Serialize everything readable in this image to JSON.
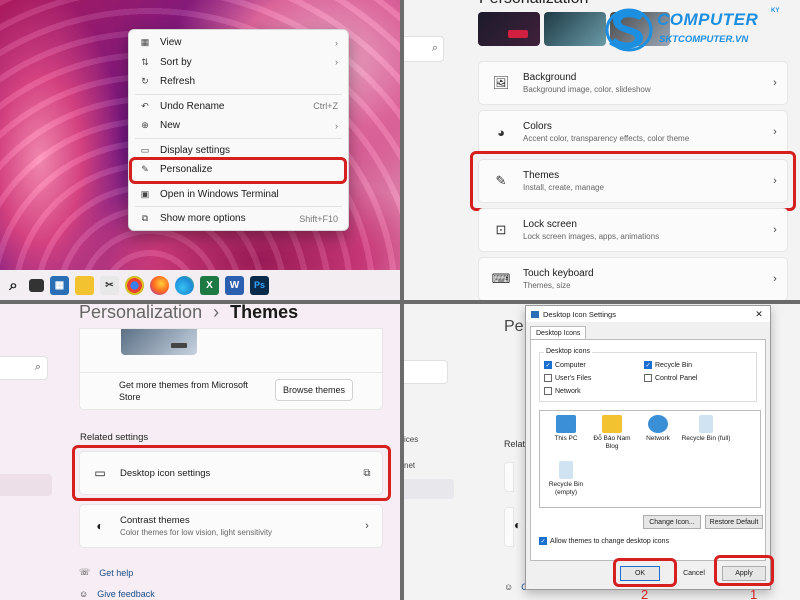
{
  "context_menu": {
    "items": [
      {
        "icon": "view-icon",
        "label": "View",
        "shortcut": "",
        "arrow": "›"
      },
      {
        "icon": "sort-icon",
        "label": "Sort by",
        "shortcut": "",
        "arrow": "›"
      },
      {
        "icon": "refresh-icon",
        "label": "Refresh",
        "shortcut": "",
        "arrow": ""
      },
      {
        "icon": "undo-icon",
        "label": "Undo Rename",
        "shortcut": "Ctrl+Z",
        "arrow": ""
      },
      {
        "icon": "new-icon",
        "label": "New",
        "shortcut": "",
        "arrow": "›"
      },
      {
        "icon": "display-icon",
        "label": "Display settings",
        "shortcut": "",
        "arrow": ""
      },
      {
        "icon": "brush-icon",
        "label": "Personalize",
        "shortcut": "",
        "arrow": ""
      },
      {
        "icon": "terminal-icon",
        "label": "Open in Windows Terminal",
        "shortcut": "",
        "arrow": ""
      },
      {
        "icon": "more-options-icon",
        "label": "Show more options",
        "shortcut": "Shift+F10",
        "arrow": ""
      }
    ]
  },
  "settings_list": {
    "partial_title": "Personalization",
    "cards": [
      {
        "icon": "background-icon",
        "title": "Background",
        "subtitle": "Background image, color, slideshow"
      },
      {
        "icon": "colors-icon",
        "title": "Colors",
        "subtitle": "Accent color, transparency effects, color theme"
      },
      {
        "icon": "brush-icon",
        "title": "Themes",
        "subtitle": "Install, create, manage"
      },
      {
        "icon": "lock-screen-icon",
        "title": "Lock screen",
        "subtitle": "Lock screen images, apps, animations"
      },
      {
        "icon": "keyboard-icon",
        "title": "Touch keyboard",
        "subtitle": "Themes, size"
      }
    ]
  },
  "themes_page": {
    "breadcrumb_parent": "Personalization",
    "breadcrumb_sep": "›",
    "breadcrumb_current": "Themes",
    "get_more": "Get more themes from Microsoft Store",
    "browse_button": "Browse themes",
    "related_heading": "Related settings",
    "desktop_icon_settings": "Desktop icon settings",
    "contrast_title": "Contrast themes",
    "contrast_subtitle": "Color themes for low vision, light sensitivity",
    "get_help": "Get help",
    "give_feedback": "Give feedback"
  },
  "dialog_page": {
    "partial_title": "Pe",
    "partial_related": "Relat",
    "partial_item1": "ices",
    "partial_item2": "net",
    "give_feedback": "Give feedback"
  },
  "dialog": {
    "title": "Desktop Icon Settings",
    "tab": "Desktop Icons",
    "group_label": "Desktop icons",
    "checkboxes": [
      {
        "label": "Computer",
        "checked": true
      },
      {
        "label": "Recycle Bin",
        "checked": true
      },
      {
        "label": "User's Files",
        "checked": false
      },
      {
        "label": "Control Panel",
        "checked": false
      },
      {
        "label": "Network",
        "checked": false
      }
    ],
    "icons": [
      {
        "label": "This PC",
        "color": "#3a8fd6"
      },
      {
        "label": "Đỗ Bảo Nam Blog",
        "color": "#f2c230"
      },
      {
        "label": "Network",
        "color": "#3a8fd6"
      },
      {
        "label": "Recycle Bin (full)",
        "color": "#cfe3f3"
      },
      {
        "label": "Recycle Bin (empty)",
        "color": "#cfe3f3"
      }
    ],
    "change_icon": "Change Icon...",
    "restore_default": "Restore Default",
    "allow_themes": "Allow themes to change desktop icons",
    "ok": "OK",
    "cancel": "Cancel",
    "apply": "Apply",
    "step_ok": "2",
    "step_apply": "1"
  },
  "logo": {
    "line1": "COMPUTER",
    "line2": "SKTCOMPUTER.VN",
    "suffix": "KY"
  },
  "colors": {
    "highlight": "#d61f1f",
    "accent": "#1a6fd0",
    "logo_blue": "#1d8fe0"
  }
}
